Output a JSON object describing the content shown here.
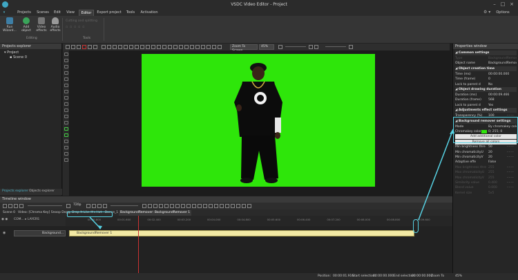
{
  "window": {
    "title": "VSDC Video Editor - Project"
  },
  "menu": {
    "items": [
      "Projects",
      "Scenes",
      "Edit",
      "View",
      "Editor",
      "Export project",
      "Tools",
      "Activation"
    ],
    "active": "Editor",
    "options": "Options"
  },
  "ribbon": {
    "run_wizard": "Run Wizard...",
    "add_object": "Add object",
    "video_effects": "Video effects",
    "audio_effects": "Audio effects",
    "group_editing": "Editing",
    "cutting_splitting": "Cutting and splitting",
    "group_tools": "Tools"
  },
  "projects_explorer": {
    "title": "Projects explorer",
    "root": "Project",
    "child": "Scene 0",
    "tab_active": "Projects explorer",
    "tab_other": "Objects explorer"
  },
  "toolbar": {
    "zoom_mode": "Zoom To Screen",
    "zoom_level": "45%"
  },
  "properties": {
    "title": "Properties window",
    "rows": [
      {
        "type": "section",
        "label": "Common settings"
      },
      {
        "type": "row",
        "label": "Type",
        "value": "BackgroundRemover",
        "dim": true
      },
      {
        "type": "row",
        "label": "Object name",
        "value": "BackgroundRemover"
      },
      {
        "type": "section",
        "label": "Object creation time"
      },
      {
        "type": "row",
        "label": "Time (ms)",
        "value": "00:00:00.000"
      },
      {
        "type": "row",
        "label": "Time (frame)",
        "value": "0"
      },
      {
        "type": "row",
        "label": "Lock to parent d",
        "value": "No"
      },
      {
        "type": "section",
        "label": "Object drawing duration"
      },
      {
        "type": "row",
        "label": "Duration (ms)",
        "value": "00:00:09.466"
      },
      {
        "type": "row",
        "label": "Duration (frame)",
        "value": "568"
      },
      {
        "type": "row",
        "label": "Lock to parent d",
        "value": "Yes"
      },
      {
        "type": "section",
        "label": "Adjustments effect settings"
      },
      {
        "type": "row",
        "label": "Transparency (%)",
        "value": "100"
      },
      {
        "type": "section",
        "label": "Background remover settings"
      },
      {
        "type": "row",
        "label": "Mode",
        "value": "By chromakey color"
      },
      {
        "type": "row",
        "label": "Chromakey color",
        "value": "0; 255; 0"
      },
      {
        "type": "button",
        "label": "Add additional color"
      },
      {
        "type": "button",
        "label": "Remove all colors"
      },
      {
        "type": "row",
        "label": "Min brightness thre",
        "value": "50"
      },
      {
        "type": "row",
        "label": "Min chromaticityU",
        "value": "20"
      },
      {
        "type": "row",
        "label": "Min chromaticityV",
        "value": "20"
      },
      {
        "type": "row",
        "label": "Adaptive effe",
        "value": "False"
      },
      {
        "type": "row",
        "label": "Max brightness thre",
        "value": "255",
        "dim": true
      },
      {
        "type": "row",
        "label": "Max chromaticityU",
        "value": "255",
        "dim": true
      },
      {
        "type": "row",
        "label": "Max chromaticityV",
        "value": "255",
        "dim": true
      },
      {
        "type": "row",
        "label": "Similarity value",
        "value": "0.400",
        "dim": true
      },
      {
        "type": "row",
        "label": "Blend value",
        "value": "0.000",
        "dim": true
      },
      {
        "type": "row",
        "label": "Kernel size",
        "value": "5x5",
        "dim": true
      }
    ],
    "tab_active": "Properties window",
    "tab_other": "Resources window"
  },
  "timeline": {
    "title": "Timeline window",
    "resolution": "720p",
    "tabs": [
      "Scene 0",
      "Video: [Chroma Key] Snoop Dogg, Drop It Like It's Hot - Dance_1",
      "BackgroundRemover: BackgroundRemover 1"
    ],
    "track_header": "COM... ▸ LAYERS",
    "track_name": "Background...",
    "clip_label": "BackgroundRemover 1",
    "ruler_ticks": [
      "00:00.800",
      "00:01.600",
      "00:02.400",
      "00:03.200",
      "00:04.000",
      "00:04.800",
      "00:05.600",
      "00:06.400",
      "00:07.200",
      "00:08.000",
      "00:08.800",
      "00:09.600"
    ]
  },
  "status": {
    "position": "Position:",
    "position_value": "00:00:01.916",
    "start_selection": "Start selection:",
    "start_value": "00:00:00.000",
    "end_selection": "End selection:",
    "end_value": "00:00:00.000",
    "zoom": "Zoom To Screen",
    "zoom_value": "45%"
  },
  "colors": {
    "chroma": "#2ee60a",
    "accent": "#57d2e4",
    "clip": "#f2e9a4"
  }
}
